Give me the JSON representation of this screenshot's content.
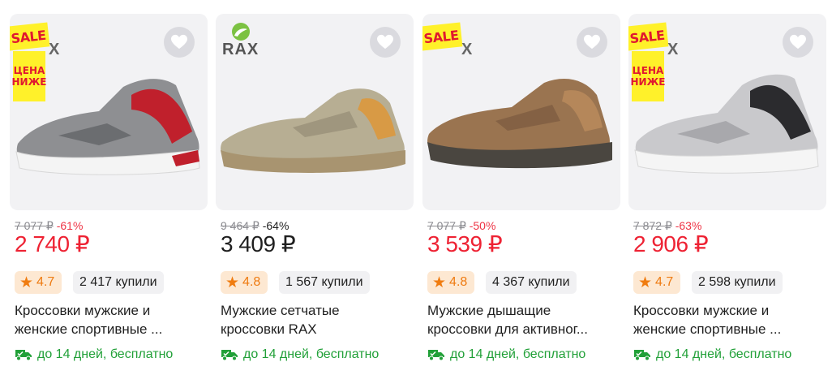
{
  "products": [
    {
      "sale_label": "SALE",
      "lower_label": [
        "ЦЕНА",
        "НИЖЕ"
      ],
      "brand_small": "X",
      "old_price": "7 077 ₽",
      "discount": "-61%",
      "price": "2 740 ₽",
      "rating": "4.7",
      "bought": "2 417 купили",
      "title_lines": [
        "Кроссовки мужские и",
        "женские спортивные ..."
      ],
      "delivery": "до 14 дней, бесплатно",
      "colors": {
        "main": "#8e8f92",
        "accent": "#c0202c",
        "sole": "#f4f4f4"
      }
    },
    {
      "brand": "RAX",
      "old_price": "9 464 ₽",
      "discount": "-64%",
      "price": "3 409 ₽",
      "rating": "4.8",
      "bought": "1 567 купили",
      "title_lines": [
        "Мужские сетчатые",
        "кроссовки RAX"
      ],
      "delivery": "до 14 дней, бесплатно",
      "colors": {
        "main": "#b7ae93",
        "accent": "#d89a45",
        "sole": "#a89470"
      }
    },
    {
      "sale_label": "SALE",
      "brand_small": "X",
      "old_price": "7 077 ₽",
      "discount": "-50%",
      "price": "3 539 ₽",
      "rating": "4.8",
      "bought": "4 367 купили",
      "title_lines": [
        "Мужские дышащие",
        "кроссовки для активног..."
      ],
      "delivery": "до 14 дней, бесплатно",
      "colors": {
        "main": "#9a7450",
        "accent": "#b5875a",
        "sole": "#4a4640"
      }
    },
    {
      "sale_label": "SALE",
      "lower_label": [
        "ЦЕНА",
        "НИЖЕ"
      ],
      "brand_small": "X",
      "old_price": "7 872 ₽",
      "discount": "-63%",
      "price": "2 906 ₽",
      "rating": "4.7",
      "bought": "2 598 купили",
      "title_lines": [
        "Кроссовки мужские и",
        "женские спортивные ..."
      ],
      "delivery": "до 14 дней, бесплатно",
      "colors": {
        "main": "#c9c9cc",
        "accent": "#2b2b2e",
        "sole": "#f5f5f5"
      }
    }
  ],
  "icons": {
    "favorite": "heart-icon",
    "rating": "star-icon",
    "delivery": "truck-icon"
  },
  "theme": {
    "price_red": "#ee2233",
    "delivery_green": "#21a038",
    "rating_orange": "#f07c10"
  }
}
